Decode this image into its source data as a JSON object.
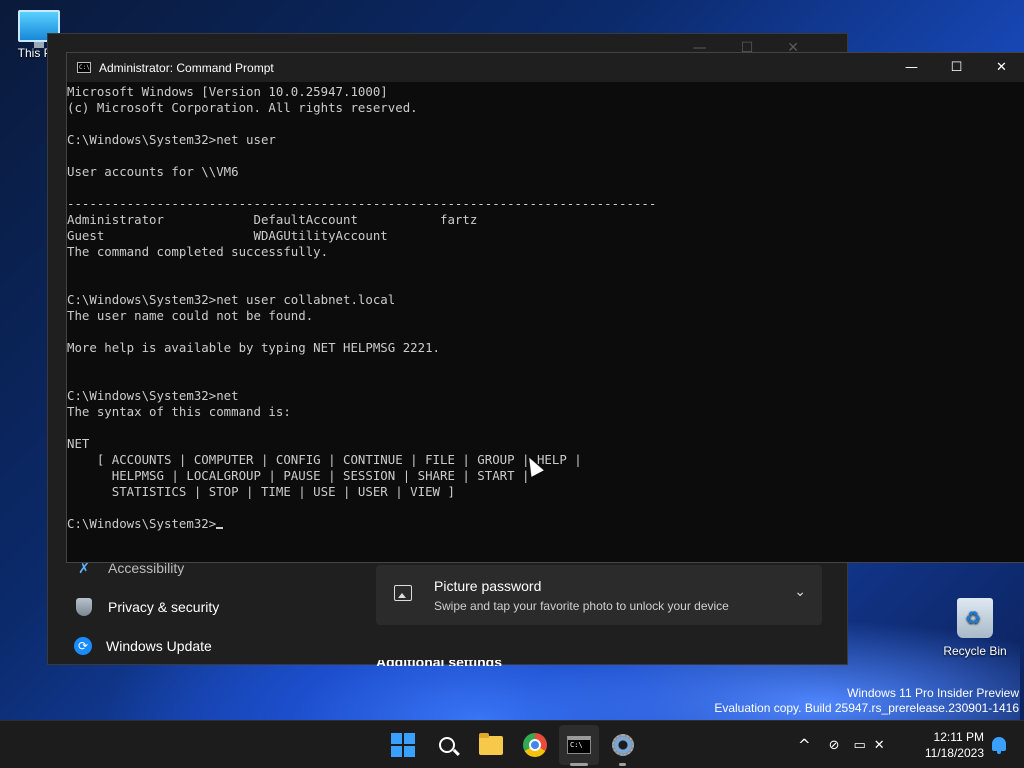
{
  "desktop": {
    "this_pc_label": "This PC",
    "recycle_bin_label": "Recycle Bin"
  },
  "settings_window": {
    "nav_items": [
      {
        "label": "Accessibility",
        "icon": "accessibility-icon"
      },
      {
        "label": "Privacy & security",
        "icon": "shield-icon"
      },
      {
        "label": "Windows Update",
        "icon": "update-icon"
      }
    ],
    "card": {
      "title": "Picture password",
      "subtitle": "Swipe and tap your favorite photo to unlock your device",
      "icon": "picture-icon"
    },
    "cutoff_heading": "Additional settings"
  },
  "cmd": {
    "title": "Administrator: Command Prompt",
    "minimize_glyph": "—",
    "maximize_glyph": "☐",
    "close_glyph": "✕",
    "lines": [
      "Microsoft Windows [Version 10.0.25947.1000]",
      "(c) Microsoft Corporation. All rights reserved.",
      "",
      "C:\\Windows\\System32>net user",
      "",
      "User accounts for \\\\VM6",
      "",
      "-------------------------------------------------------------------------------",
      "Administrator            DefaultAccount           fartz",
      "Guest                    WDAGUtilityAccount",
      "The command completed successfully.",
      "",
      "",
      "C:\\Windows\\System32>net user collabnet.local",
      "The user name could not be found.",
      "",
      "More help is available by typing NET HELPMSG 2221.",
      "",
      "",
      "C:\\Windows\\System32>net",
      "The syntax of this command is:",
      "",
      "NET",
      "    [ ACCOUNTS | COMPUTER | CONFIG | CONTINUE | FILE | GROUP | HELP |",
      "      HELPMSG | LOCALGROUP | PAUSE | SESSION | SHARE | START |",
      "      STATISTICS | STOP | TIME | USE | USER | VIEW ]",
      ""
    ],
    "prompt": "C:\\Windows\\System32>"
  },
  "watermark": {
    "line1": "Windows 11 Pro Insider Preview",
    "line2": "Evaluation copy. Build 25947.rs_prerelease.230901-1416"
  },
  "taskbar": {
    "time": "12:11 PM",
    "date": "11/18/2023",
    "tray_chevron": "^"
  },
  "colors": {
    "cmd_bg": "#0c0c0c",
    "cmd_text": "#cccccc",
    "accent": "#3aa0ff"
  }
}
